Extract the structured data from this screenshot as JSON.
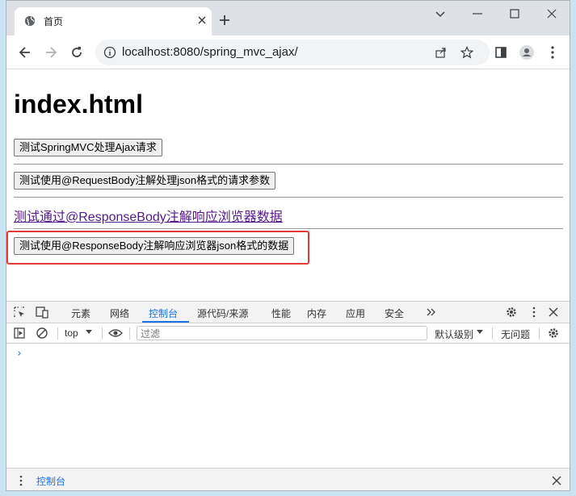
{
  "browser": {
    "tab_title": "首页",
    "url": "localhost:8080/spring_mvc_ajax/"
  },
  "page": {
    "heading": "index.html",
    "button1": "测试SpringMVC处理Ajax请求",
    "button2": "测试使用@RequestBody注解处理json格式的请求参数",
    "link": "测试通过@ResponseBody注解响应浏览器数据",
    "button3": "测试使用@ResponseBody注解响应浏览器json格式的数据"
  },
  "devtools": {
    "tabs": [
      "元素",
      "网络",
      "控制台",
      "源代码/来源",
      "性能",
      "内存",
      "应用",
      "安全"
    ],
    "active_tab": "控制台",
    "context": "top",
    "filter_placeholder": "过滤",
    "levels": "默认级别",
    "issues": "无问题",
    "prompt": "›",
    "drawer_tab": "控制台"
  },
  "colors": {
    "highlight": "#e53935",
    "accent": "#1a73e8",
    "link": "#551a8b"
  }
}
